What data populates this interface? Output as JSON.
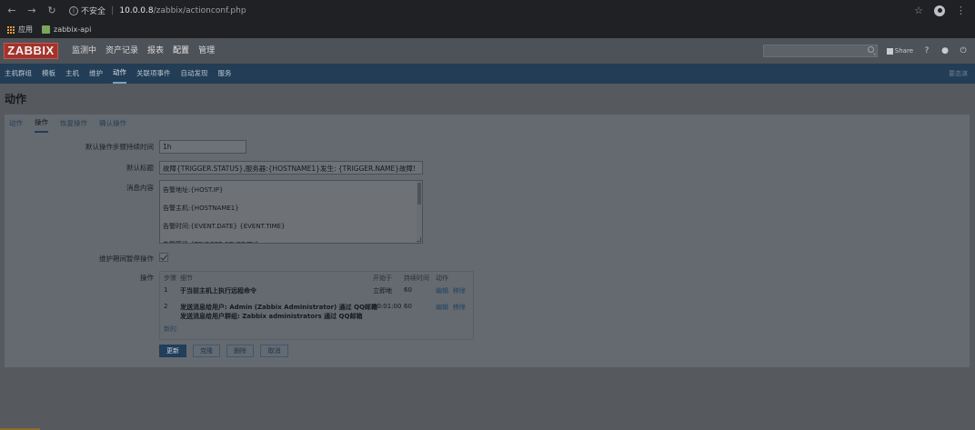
{
  "browser": {
    "security_label": "不安全",
    "url_host": "10.0.0.8",
    "url_path": "/zabbix/actionconf.php",
    "bookmarks": [
      {
        "label": "应用",
        "icon": "apps-icon"
      },
      {
        "label": "zabbix-api",
        "icon": "bookmark-favicon"
      }
    ]
  },
  "header": {
    "logo": "ZABBIX",
    "menu": [
      "监测中",
      "资产记录",
      "报表",
      "配置",
      "管理"
    ],
    "active_menu": "配置",
    "share_label": "Share",
    "help_label": "?"
  },
  "submenu": {
    "items": [
      "主机群组",
      "模板",
      "主机",
      "维护",
      "动作",
      "关联项事件",
      "自动发现",
      "服务"
    ],
    "active": "动作",
    "right_label": "要态演"
  },
  "page": {
    "title": "动作",
    "tabs": [
      "动作",
      "操作",
      "恢复操作",
      "确认操作"
    ],
    "active_tab": "操作"
  },
  "form": {
    "step_duration_label": "默认操作步骤持续时间",
    "step_duration_value": "1h",
    "subject_label": "默认标题",
    "subject_value": "故障{TRIGGER.STATUS},服务器:{HOSTNAME1}发生: {TRIGGER.NAME}故障!",
    "message_label": "消息内容",
    "message_lines": [
      "告警地址:{HOST.IP}",
      "告警主机:{HOSTNAME1}",
      "告警时间:{EVENT.DATE} {EVENT.TIME}",
      "告警等级:{TRIGGER.SEVERITY}"
    ],
    "pause_label": "维护期间暂停操作",
    "pause_checked": true,
    "operations_label": "操作"
  },
  "operations": {
    "headers": {
      "steps": "步骤",
      "details": "细节",
      "start_in": "开始于",
      "duration": "持续时间",
      "action": "动作"
    },
    "rows": [
      {
        "step": "1",
        "detail": "于当前主机上执行远程命令",
        "detail2": "",
        "start_in": "立即地",
        "duration": "60",
        "edit": "编辑",
        "remove": "移除"
      },
      {
        "step": "2",
        "detail": "发送消息给用户: Admin (Zabbix Administrator) 通过 QQ邮箱",
        "detail2": "发送消息给用户群组: Zabbix administrators 通过 QQ邮箱",
        "start_in": "00:01:00",
        "duration": "60",
        "edit": "编辑",
        "remove": "移除"
      }
    ],
    "new_label": "新的"
  },
  "buttons": {
    "update": "更新",
    "clone": "克隆",
    "delete": "删除",
    "cancel": "取消"
  }
}
